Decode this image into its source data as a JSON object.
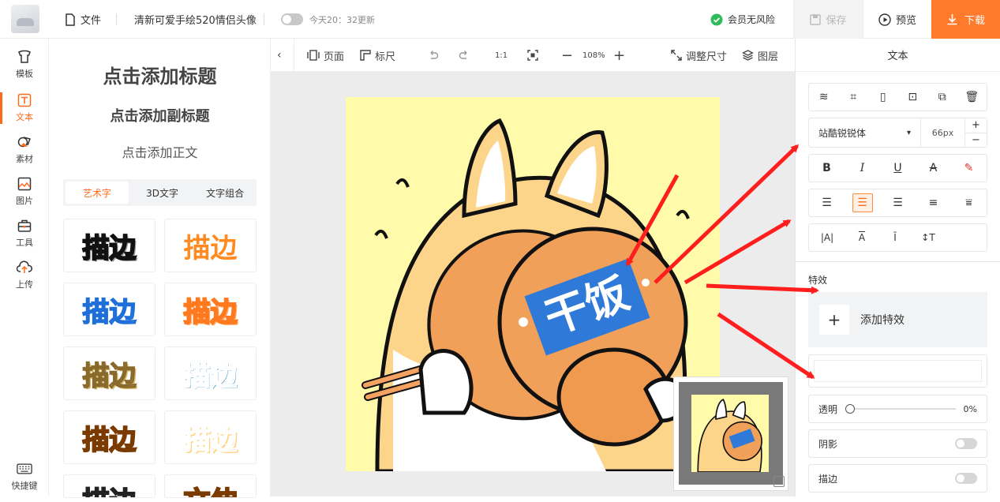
{
  "header": {
    "file_label": "文件",
    "title": "清新可爱手绘520情侣头像",
    "autosave": "今天20：32更新",
    "membership": "会员无风险",
    "save": "保存",
    "preview": "预览",
    "download": "下载"
  },
  "sidebar": {
    "items": [
      {
        "label": "模板",
        "icon": "template-icon"
      },
      {
        "label": "文本",
        "icon": "text-icon",
        "active": true
      },
      {
        "label": "素材",
        "icon": "material-icon"
      },
      {
        "label": "图片",
        "icon": "image-icon"
      },
      {
        "label": "工具",
        "icon": "toolbox-icon"
      },
      {
        "label": "上传",
        "icon": "upload-icon"
      }
    ],
    "shortcuts": "快捷键"
  },
  "text_panel": {
    "add_title": "点击添加标题",
    "add_subtitle": "点击添加副标题",
    "add_body": "点击添加正文",
    "tabs": [
      "艺术字",
      "3D文字",
      "文字组合"
    ],
    "active_tab": "艺术字",
    "samples": [
      "描边",
      "描边",
      "描边",
      "描边",
      "描边",
      "描边",
      "描边",
      "描边",
      "描边",
      "文伸"
    ]
  },
  "canvas_toolbar": {
    "page": "页面",
    "ruler": "标尺",
    "ratio": "1:1",
    "zoom": "108%",
    "resize": "调整尺寸",
    "layers": "图层"
  },
  "artboard": {
    "sticker_text": "干饭"
  },
  "right_panel": {
    "title": "文本",
    "font": "站酷锐锐体",
    "font_size": "66px",
    "effects_label": "特效",
    "add_effect": "添加特效",
    "opacity_label": "透明",
    "opacity_value": "0%",
    "shadow_label": "阴影",
    "stroke_label": "描边"
  },
  "colors": {
    "accent": "#ff7a2b",
    "sticker_blue": "#2f7ad8",
    "bg_yellow": "#fffbaa",
    "arrow_red": "#ff1e1e"
  }
}
